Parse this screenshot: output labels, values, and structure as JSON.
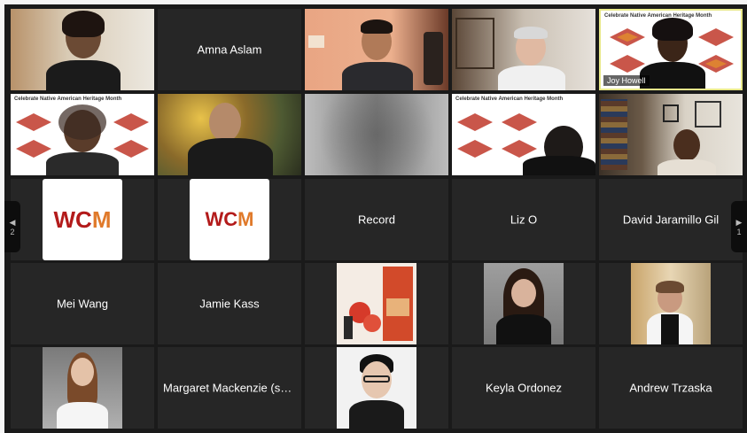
{
  "participants": [
    {
      "type": "video",
      "name": ""
    },
    {
      "type": "name",
      "name": "Amna Aslam"
    },
    {
      "type": "video",
      "name": ""
    },
    {
      "type": "video",
      "name": ""
    },
    {
      "type": "video",
      "name": "Joy Howell",
      "active": true
    },
    {
      "type": "video",
      "name": ""
    },
    {
      "type": "video",
      "name": ""
    },
    {
      "type": "blur",
      "name": ""
    },
    {
      "type": "video",
      "name": ""
    },
    {
      "type": "video",
      "name": ""
    },
    {
      "type": "logo",
      "name": ""
    },
    {
      "type": "logo",
      "name": ""
    },
    {
      "type": "name",
      "name": "Record"
    },
    {
      "type": "name",
      "name": "Liz O"
    },
    {
      "type": "name",
      "name": "David Jaramillo Gil"
    },
    {
      "type": "name",
      "name": "Mei Wang"
    },
    {
      "type": "name",
      "name": "Jamie Kass"
    },
    {
      "type": "photo",
      "name": ""
    },
    {
      "type": "photo",
      "name": ""
    },
    {
      "type": "photo",
      "name": ""
    },
    {
      "type": "photo",
      "name": ""
    },
    {
      "type": "name",
      "name": "Margaret Mackenzie (sh..."
    },
    {
      "type": "photo",
      "name": ""
    },
    {
      "type": "name",
      "name": "Keyla Ordonez"
    },
    {
      "type": "name",
      "name": "Andrew Trzaska"
    }
  ],
  "logo": {
    "w": "WC",
    "m": "M"
  },
  "banner_text": "Celebrate Native American Heritage Month",
  "nav": {
    "prev_page": "2",
    "next_page": "1"
  },
  "colors": {
    "active_border": "#e8e88a",
    "tile_bg": "#262626",
    "stage_bg": "#1a1a1a",
    "logo_red": "#b31b1b",
    "logo_orange": "#e07a2b"
  }
}
